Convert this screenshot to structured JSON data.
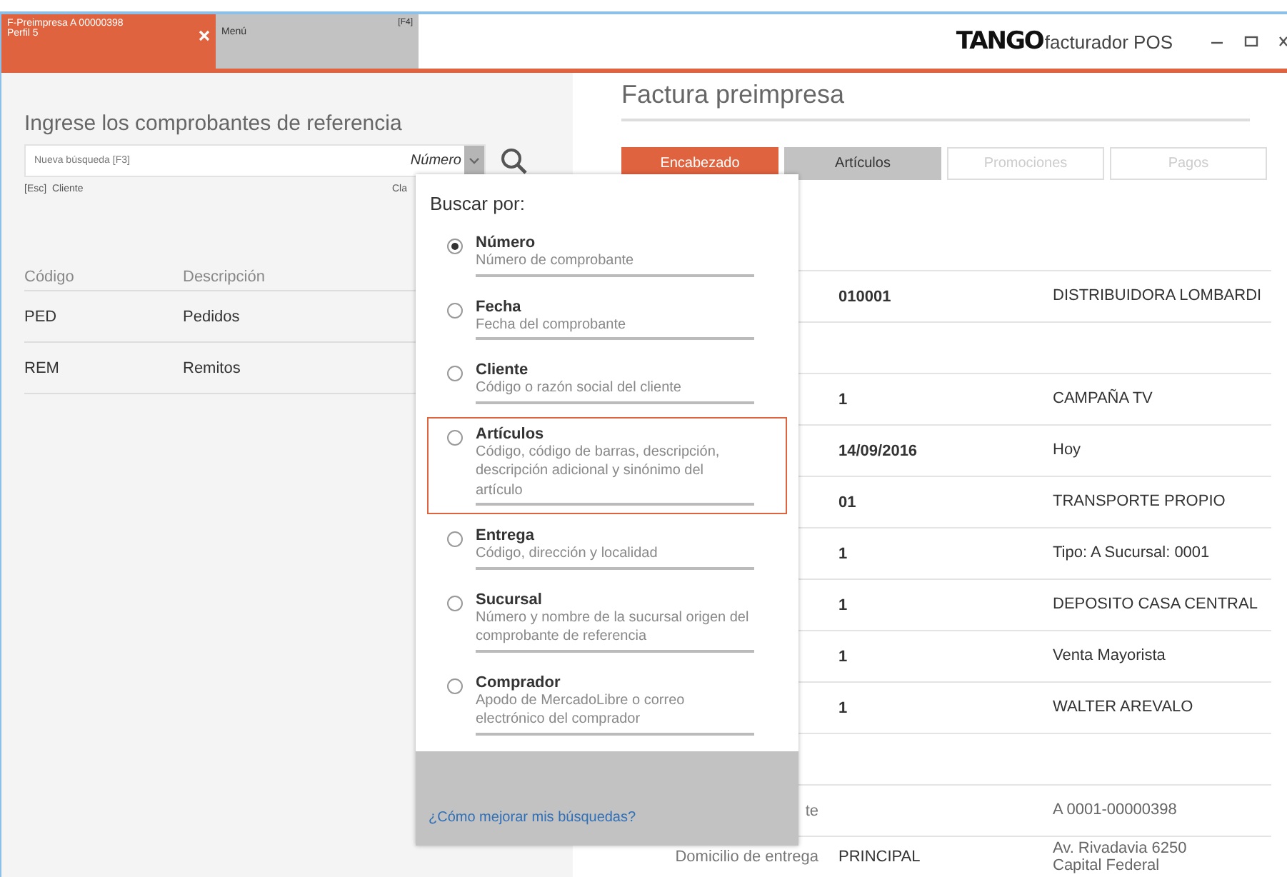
{
  "tabs": [
    {
      "label": "F-Preimpresa A 00000398",
      "sublabel": "Perfil 5",
      "selected": true
    },
    {
      "label": "Menú",
      "shortcut": "[F4]",
      "selected": false
    }
  ],
  "logo": {
    "brand": "TANGO",
    "product": "facturador POS"
  },
  "search_panel": {
    "title": "Ingrese los comprobantes de referencia",
    "search": {
      "placeholder": "Nueva búsqueda [F3]"
    },
    "search_by": "Número",
    "hints": [
      "[Esc]  Cliente",
      "Cla"
    ],
    "table": {
      "columns": [
        "Código",
        "Descripción"
      ],
      "rows": [
        [
          "PED",
          "Pedidos"
        ],
        [
          "REM",
          "Remitos"
        ]
      ]
    }
  },
  "document": {
    "title": "Factura preimpresa",
    "tabs": [
      {
        "label": "Encabezado",
        "selected": true,
        "disabled": false
      },
      {
        "label": "Artículos",
        "selected": false,
        "disabled": false
      },
      {
        "label": "Promociones",
        "selected": false,
        "disabled": true
      },
      {
        "label": "Pagos",
        "selected": false,
        "disabled": true
      }
    ],
    "rows": [
      {
        "code": "010001",
        "value": "DISTRIBUIDORA LOMBARDI"
      },
      {
        "kind": "blank"
      },
      {
        "code": "1",
        "value": "CAMPAÑA TV"
      },
      {
        "code": "14/09/2016",
        "value": "Hoy"
      },
      {
        "code": "01",
        "value": "TRANSPORTE PROPIO"
      },
      {
        "code": "1",
        "value": "Tipo: A   Sucursal: 0001"
      },
      {
        "code": "1",
        "value": "DEPOSITO CASA CENTRAL"
      },
      {
        "code": "1",
        "value": "Venta Mayorista"
      },
      {
        "code": "1",
        "value": "WALTER AREVALO"
      },
      {
        "kind": "blank"
      },
      {
        "kind": "info",
        "label": "te",
        "value": "A 0001-00000398"
      },
      {
        "kind": "info",
        "label": "Domicilio de entrega",
        "code": "PRINCIPAL",
        "value": "Av. Rivadavia 6250\nCapital Federal"
      }
    ]
  },
  "search_popup": {
    "title": "Buscar por:",
    "options": [
      {
        "label": "Número",
        "description": "Número de comprobante",
        "selected": true,
        "highlighted": false
      },
      {
        "label": "Fecha",
        "description": "Fecha del comprobante",
        "selected": false,
        "highlighted": false
      },
      {
        "label": "Cliente",
        "description": "Código o razón social del cliente",
        "selected": false,
        "highlighted": false
      },
      {
        "label": "Artículos",
        "description": "Código, código de barras, descripción, descripción adicional y sinónimo del artículo",
        "selected": false,
        "highlighted": true
      },
      {
        "label": "Entrega",
        "description": "Código, dirección y localidad",
        "selected": false,
        "highlighted": false
      },
      {
        "label": "Sucursal",
        "description": "Número y nombre de la sucursal origen del comprobante de referencia",
        "selected": false,
        "highlighted": false
      },
      {
        "label": "Comprador",
        "description": "Apodo de MercadoLibre o correo electrónico del comprador",
        "selected": false,
        "highlighted": false
      }
    ],
    "help_link": "¿Cómo mejorar mis búsquedas?"
  }
}
